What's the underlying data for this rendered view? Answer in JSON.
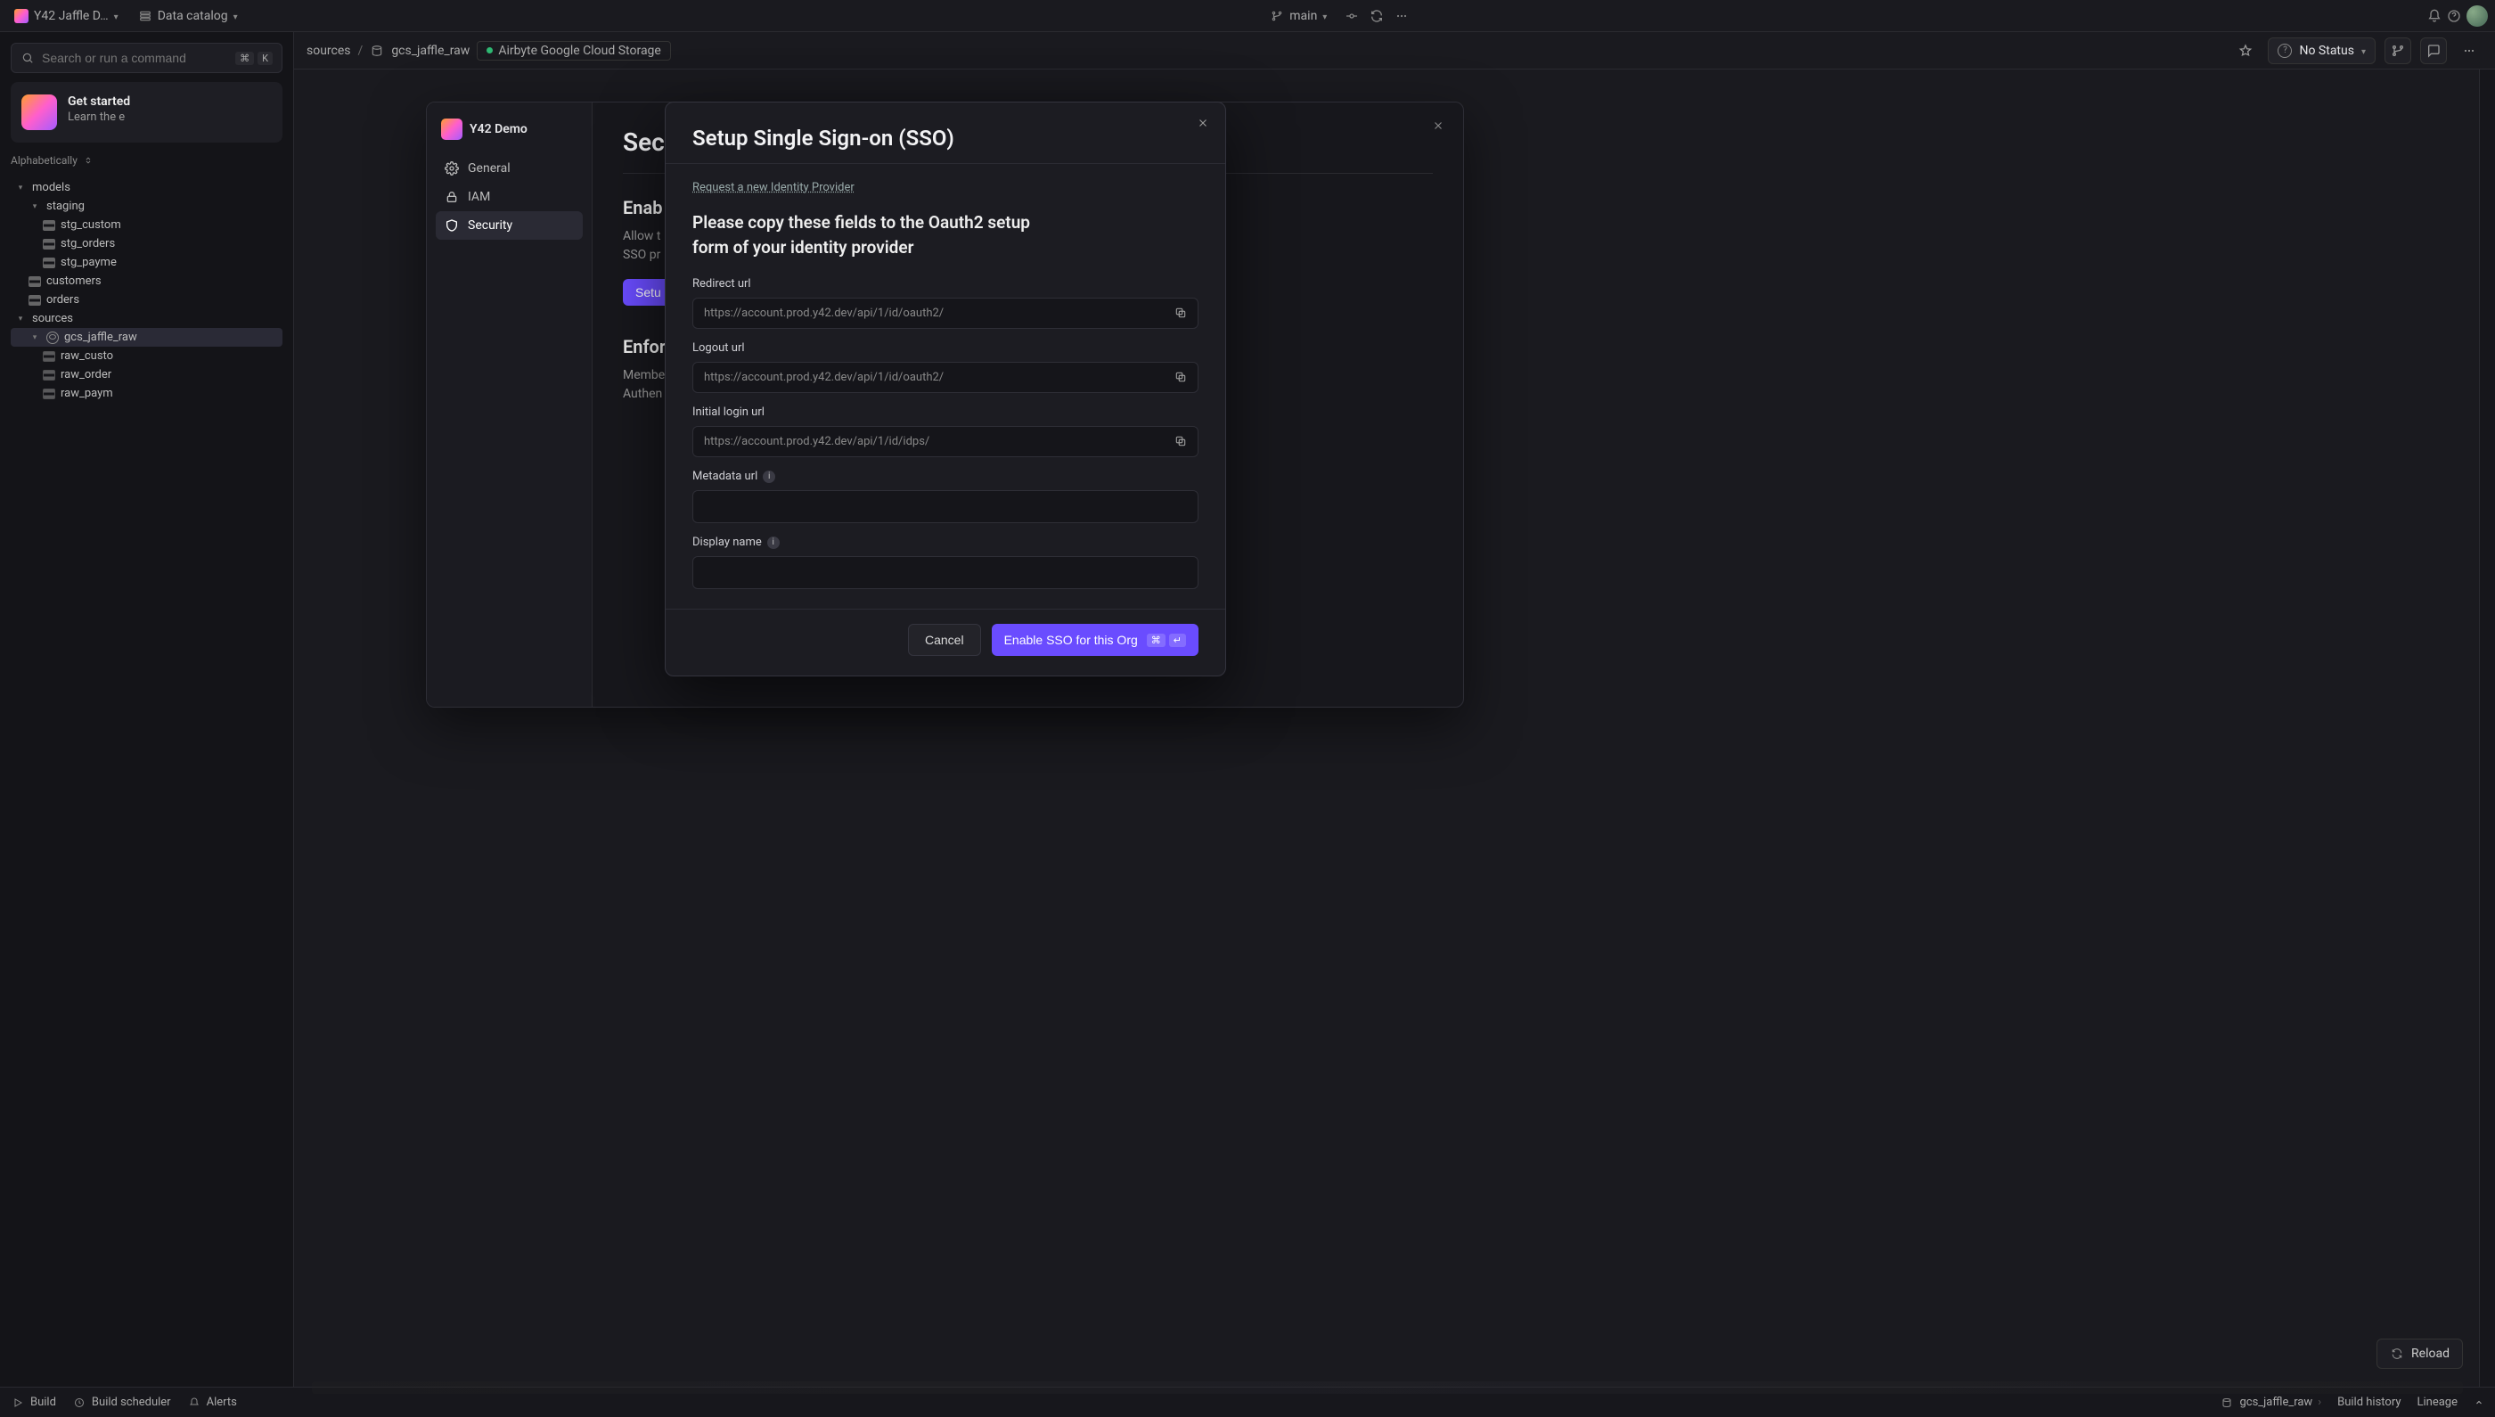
{
  "topbar": {
    "workspace": "Y42 Jaffle D…",
    "catalog": "Data catalog",
    "branch": "main",
    "search_placeholder": "Search or run a command",
    "kbd1": "⌘",
    "kbd2": "K"
  },
  "getstarted": {
    "title": "Get started",
    "subtitle": "Learn the e"
  },
  "tree": {
    "sort_label": "Alphabetically",
    "models_label": "models",
    "staging_label": "staging",
    "stg_customers": "stg_custom",
    "stg_orders": "stg_orders",
    "stg_payments": "stg_payme",
    "customers": "customers",
    "orders": "orders",
    "sources_label": "sources",
    "gcs_jaffle_raw": "gcs_jaffle_raw",
    "raw_customers": "raw_custo",
    "raw_orders": "raw_order",
    "raw_payments": "raw_paym"
  },
  "breadcrumb": {
    "sources": "sources",
    "sep": "/",
    "gcs": "gcs_jaffle_raw",
    "airbyte": "Airbyte Google Cloud Storage"
  },
  "header_actions": {
    "status_label": "No Status",
    "reload": "Reload"
  },
  "settings": {
    "org_name": "Y42 Demo",
    "nav_general": "General",
    "nav_iam": "IAM",
    "nav_security": "Security",
    "title": "Sec",
    "sect_enable_title": "Enab",
    "sect_enable_desc_line1": "Allow t",
    "sect_enable_desc_line2": "SSO pr",
    "setup_btn": "Setu",
    "sect_enforce_title": "Enfor",
    "sect_enforce_desc_line1": "Membe",
    "sect_enforce_desc_line2": "Authen"
  },
  "sso": {
    "title": "Setup Single Sign-on (SSO)",
    "request_link": "Request a new Identity Provider",
    "lead": "Please copy these fields to the Oauth2 setup form of your identity provider",
    "redirect_label": "Redirect url",
    "redirect_value": "https://account.prod.y42.dev/api/1/id/oauth2/",
    "logout_label": "Logout url",
    "logout_value": "https://account.prod.y42.dev/api/1/id/oauth2/",
    "initial_label": "Initial login url",
    "initial_value": "https://account.prod.y42.dev/api/1/id/idps/",
    "metadata_label": "Metadata url",
    "display_label": "Display name",
    "cancel": "Cancel",
    "submit": "Enable SSO for this Org",
    "kbd1": "⌘",
    "kbd2": "↵"
  },
  "bottombar": {
    "build": "Build",
    "scheduler": "Build scheduler",
    "alerts": "Alerts",
    "gcs": "gcs_jaffle_raw",
    "history": "Build history",
    "lineage": "Lineage"
  }
}
